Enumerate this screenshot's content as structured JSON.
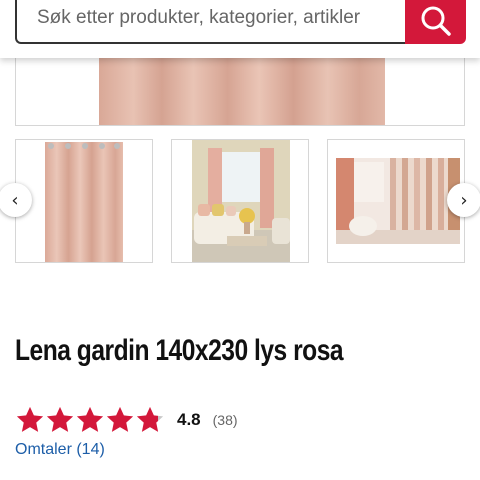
{
  "search": {
    "placeholder": "Søk etter produkter, kategorier, artikler",
    "button_icon": "search-icon"
  },
  "gallery": {
    "prev_icon": "chevron-left-icon",
    "next_icon": "chevron-right-icon",
    "prev_label": "‹",
    "next_label": "›",
    "thumbnails": [
      "curtain-product-image",
      "living-room-scene-image",
      "bright-room-scene-image"
    ]
  },
  "product": {
    "title": "Lena gardin 140x230 lys rosa",
    "rating_value": "4.8",
    "rating_stars": 4.8,
    "rating_count": "(38)",
    "reviews_link": "Omtaler (14)"
  },
  "colors": {
    "brand_red": "#d3183a",
    "star_red": "#d3183a",
    "link_blue": "#1d5ea8"
  }
}
